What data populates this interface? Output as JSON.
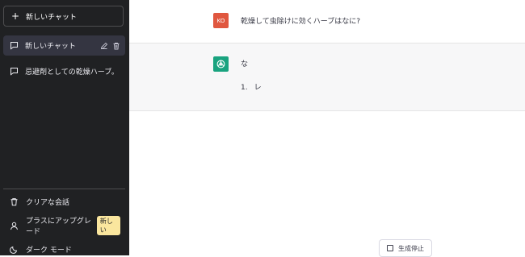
{
  "sidebar": {
    "new_chat_label": "新しいチャット",
    "conversations": [
      {
        "label": "新しいチャット",
        "active": true
      },
      {
        "label": "忌避剤としての乾燥ハーブ。",
        "active": false
      }
    ],
    "menu": {
      "clear_label": "クリアな会話",
      "upgrade_label": "プラスにアップグレード",
      "upgrade_badge": "新しい",
      "dark_mode_label": "ダーク モード"
    }
  },
  "chat": {
    "user_avatar": "KO",
    "user_message": "乾燥して虫除けに効くハーブはなに?",
    "assistant_paragraph": "な",
    "assistant_list": [
      {
        "number": "1.",
        "text": "レ"
      }
    ]
  },
  "controls": {
    "stop_label": "生成停止"
  },
  "colors": {
    "sidebar_bg": "#202123",
    "active_item_bg": "#343541",
    "user_avatar_bg": "#e0573f",
    "assistant_avatar_bg": "#19a37f",
    "badge_bg": "#fae69e"
  }
}
